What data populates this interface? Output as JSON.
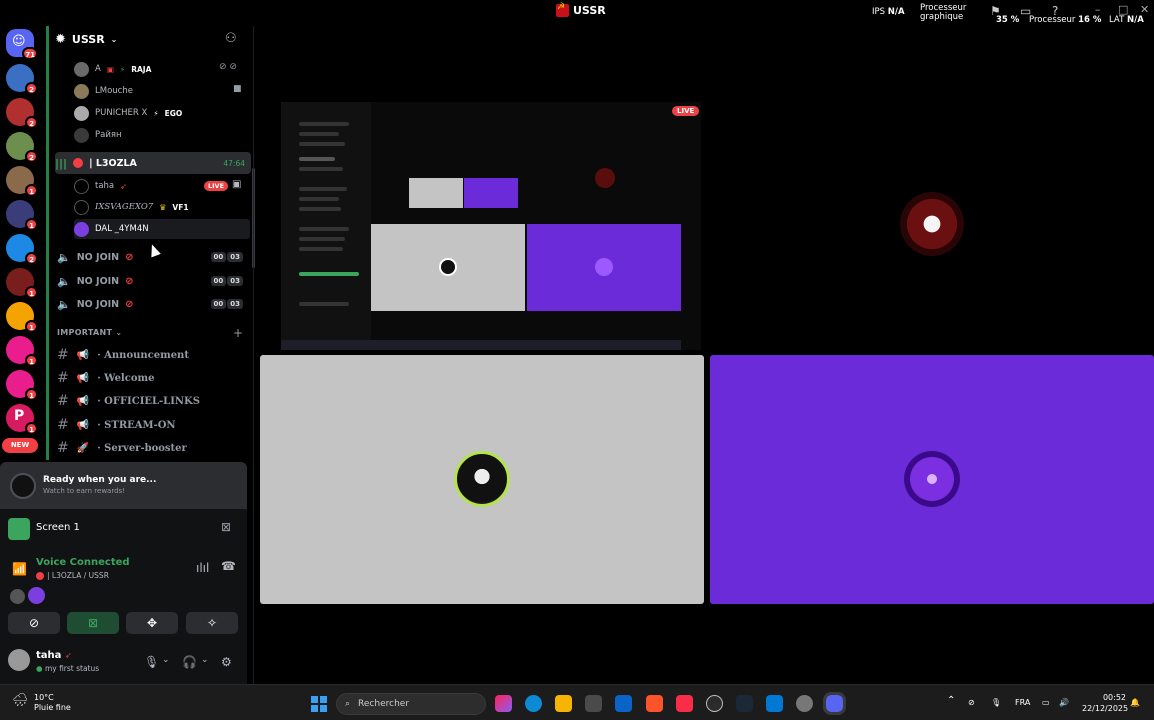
{
  "window": {
    "title": "USSR",
    "stats": {
      "ips_label": "IPS",
      "ips_value": "N/A",
      "gpu_label_1": "Processeur",
      "gpu_label_2": "graphique",
      "gpu_value": "35 %",
      "cpu_label": "Processeur",
      "cpu_value": "16 %",
      "lat_label": "LAT",
      "lat_value": "N/A"
    }
  },
  "servers": {
    "home_badge": "71",
    "badges": [
      "2",
      "2",
      "2",
      "1",
      "1",
      "2",
      "1",
      "1",
      "1",
      "1",
      "1"
    ],
    "new_label": "NEW"
  },
  "server": {
    "name": "USSR"
  },
  "voice_users_top": [
    {
      "name": "A",
      "tag": "RAJA"
    },
    {
      "name": "LMouche",
      "tag": ""
    },
    {
      "name": "PUNICHER X",
      "tag": "EGO"
    },
    {
      "name": "Райян",
      "tag": ""
    }
  ],
  "active_channel": {
    "name": "| L3OZLA",
    "timer": "47:64",
    "users": [
      {
        "name": "taha",
        "live": "LIVE"
      },
      {
        "name": "IXSVAGEXO7",
        "tag": "VF1"
      },
      {
        "name": "DAL _4YM4N"
      }
    ]
  },
  "no_join_channels": [
    {
      "name": "NO JOIN",
      "count_a": "00",
      "count_b": "03"
    },
    {
      "name": "NO JOIN",
      "count_a": "00",
      "count_b": "03"
    },
    {
      "name": "NO JOIN",
      "count_a": "00",
      "count_b": "03"
    }
  ],
  "category": {
    "name": "IMPORTANT"
  },
  "text_channels": [
    "· Announcement",
    "· Welcome",
    "· OFFICIEL-LINKS",
    "· STREAM-ON",
    "· Server-booster"
  ],
  "promo": {
    "title": "Ready when you are...",
    "subtitle": "Watch to earn rewards!"
  },
  "screen_share": {
    "label": "Screen 1"
  },
  "voice": {
    "status": "Voice Connected",
    "channel": "| L3OZLA / USSR"
  },
  "user": {
    "name": "taha",
    "status": "my first status"
  },
  "stage": {
    "live_label": "LIVE"
  },
  "taskbar": {
    "weather_temp": "10°C",
    "weather_desc": "Pluie fine",
    "search_placeholder": "Rechercher",
    "language": "FRA",
    "time": "00:52",
    "date": "22/12/2025"
  },
  "colors": {
    "green": "#3ba55d",
    "red": "#f23f43",
    "purple": "#6c2bd9",
    "grey_tile": "#c4c4c4"
  }
}
